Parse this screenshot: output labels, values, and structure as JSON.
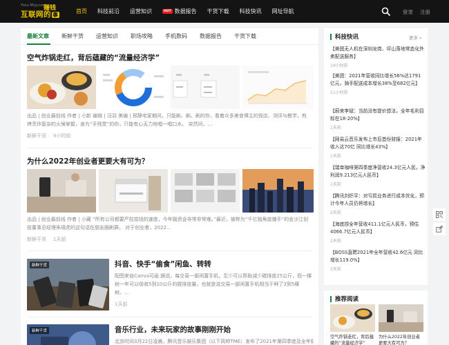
{
  "header": {
    "logo_watermark": "Yixiu Miyy.com",
    "logo_name": "互联网的",
    "logo_name2": "事",
    "logo_zhuan": "赚钱",
    "nav": [
      {
        "label": "首页",
        "active": true
      },
      {
        "label": "科技前沿"
      },
      {
        "label": "运营知识"
      },
      {
        "label": "数据报告",
        "badge": "HOT"
      },
      {
        "label": "干货下载"
      },
      {
        "label": "科技快讯"
      },
      {
        "label": "网址导航"
      }
    ],
    "login": "登录",
    "register": "注册"
  },
  "tabs": [
    "最新文章",
    "新鲜干货",
    "运营知识",
    "职场攻略",
    "手机数码",
    "数据报告",
    "干货下载"
  ],
  "articles": [
    {
      "title": "空气炸锅走红，背后蕴藏的“流量经济学”",
      "excerpt": "出品 | 创业最前线 作者 | 小新 编辑 | 冯羽 美编 | 邢静宅家期间，只能刷、刷、刷的你，看着众多美食博主的探店、测评与教学，煎烤烹炸复杂的火候掌握，身为“手残党”的你，只能有心无力地唱一唱口水。 突然间，…",
      "category": "新鲜干货",
      "time": "9小时前"
    },
    {
      "title": "为什么2022年创业者更要大有可为？",
      "excerpt": "出品 | 创业最前线 作者 | 小藏 “所有公司都要严控烧钱的速度，今年融资会非常非常难。”最近，被称为“千亿独角兽捕手”的金沙江创投董事总经理朱啸虎的这句话在朋友圈刷屏。 对于创业者，2022…",
      "category": "新鲜干货",
      "time": "1天前"
    },
    {
      "title": "抖音、快手“偷食”闲鱼、转转",
      "excerpt": "配图来自Canva可画 据说，每交易一部闲置手机，至少可以帮助减少碳排放25公斤，而一棵树一年可以吸收5到10公斤的碳排放量，也就是说交易一部闲置手机相当于种了3到5棵树。…",
      "category": "新鲜干货",
      "time": "1天前"
    },
    {
      "title": "音乐行业，未来玩家的故事刚刚开始",
      "excerpt": "北京时间3月22日凌晨，腾讯音乐娱乐集团（以下简称TME）发布了2021年第四季度及全年财",
      "category": "新鲜干货"
    }
  ],
  "sidebar": {
    "title": "科技快讯",
    "more": "更多 »",
    "items": [
      {
        "text": "【美团无人机在深圳龙岗、坪山落地常态化外卖配送服务】",
        "time": "19小时前"
      },
      {
        "text": "【美团：2021年营收同比增长56%达1791亿元，骑手配送成本增长38%至682亿元】",
        "time": "21小时前"
      },
      {
        "text": "【蔚来李斌：当前没有提价想法，全年毛利目标在18-20%】",
        "time": "1天前"
      },
      {
        "text": "【网易云音乐发布上市后首份财报：2021年收入达70亿 同比增长43%】",
        "time": "1天前"
      },
      {
        "text": "【瑞幸咖啡第四季度净营收24.3亿元人民，净利润9.213亿元人民币】",
        "time": "1天前"
      },
      {
        "text": "【腾讯刘炽平：对亏损业务进行成本优化，预计今年人员仍将增长】",
        "time": "2天前"
      },
      {
        "text": "【海底捞全年营收411.1亿元人民币，预估4066.7亿元人民币】",
        "time": "2天前"
      },
      {
        "text": "【BOSS直聘2021年全年营收42.6亿元 同比增长119.0%】",
        "time": "2天前"
      }
    ]
  },
  "recommend": {
    "title": "推荐阅读",
    "items": [
      {
        "caption": "空气炸锅走红，背后蕴藏的“流量经济学”"
      },
      {
        "caption": "为什么2022年创业者更要大有可为？"
      }
    ]
  },
  "colors": {
    "brand_green": "#1a7e3c",
    "nav_active": "#f5c400",
    "header_bg": "#141414",
    "hot_badge": "#e02020"
  }
}
